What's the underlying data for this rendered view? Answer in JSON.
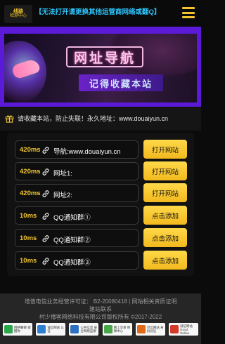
{
  "header": {
    "logo_line1": "线路",
    "logo_line2": "检测中心",
    "marquee": "【无法打开请更换其他运营商网络或翻Q】",
    "menu_icon": "hamburger-icon"
  },
  "banner": {
    "title": "网址导航",
    "subtitle": "记得收藏本站"
  },
  "notice": {
    "icon": "gift-icon",
    "text": "请收藏本站，防止失联！永久地址：www.douaiyun.cn"
  },
  "links": [
    {
      "ms": "420ms",
      "text": "导航:www.douaiyun.cn",
      "button": "打开网站"
    },
    {
      "ms": "420ms",
      "text": "网址1:",
      "button": "打开网站"
    },
    {
      "ms": "420ms",
      "text": "网址2:",
      "button": "打开网站"
    },
    {
      "ms": "10ms",
      "text": "QQ通知群①",
      "button": "点击添加"
    },
    {
      "ms": "10ms",
      "text": "QQ通知群②",
      "button": "点击添加"
    },
    {
      "ms": "10ms",
      "text": "QQ通知群③",
      "button": "点击添加"
    }
  ],
  "footer": {
    "line1": "增值电信业务经营许可证：  B2-20080418 | 网站相关资质证明",
    "line2": "建站联系",
    "line3": "村少播客网络科技有限公司版权所有 ©2017-2022",
    "badges": [
      {
        "text": "网络警察 提醒你",
        "color": "#2aa84a"
      },
      {
        "text": "诚信网站 认证",
        "color": "#2f7fd1"
      },
      {
        "text": "公共信息 安全网络监察",
        "color": "#2d6fc0"
      },
      {
        "text": "网上交易 保障中心",
        "color": "#4aa64a"
      },
      {
        "text": "可信网站 身份验证",
        "color": "#e06a1a"
      },
      {
        "text": "诚信网站 Good Online",
        "color": "#d23a2a"
      }
    ]
  },
  "colors": {
    "accent_yellow": "#f2c531",
    "marquee_blue": "#2cc7ff",
    "banner_purple": "#5b1ad7"
  }
}
